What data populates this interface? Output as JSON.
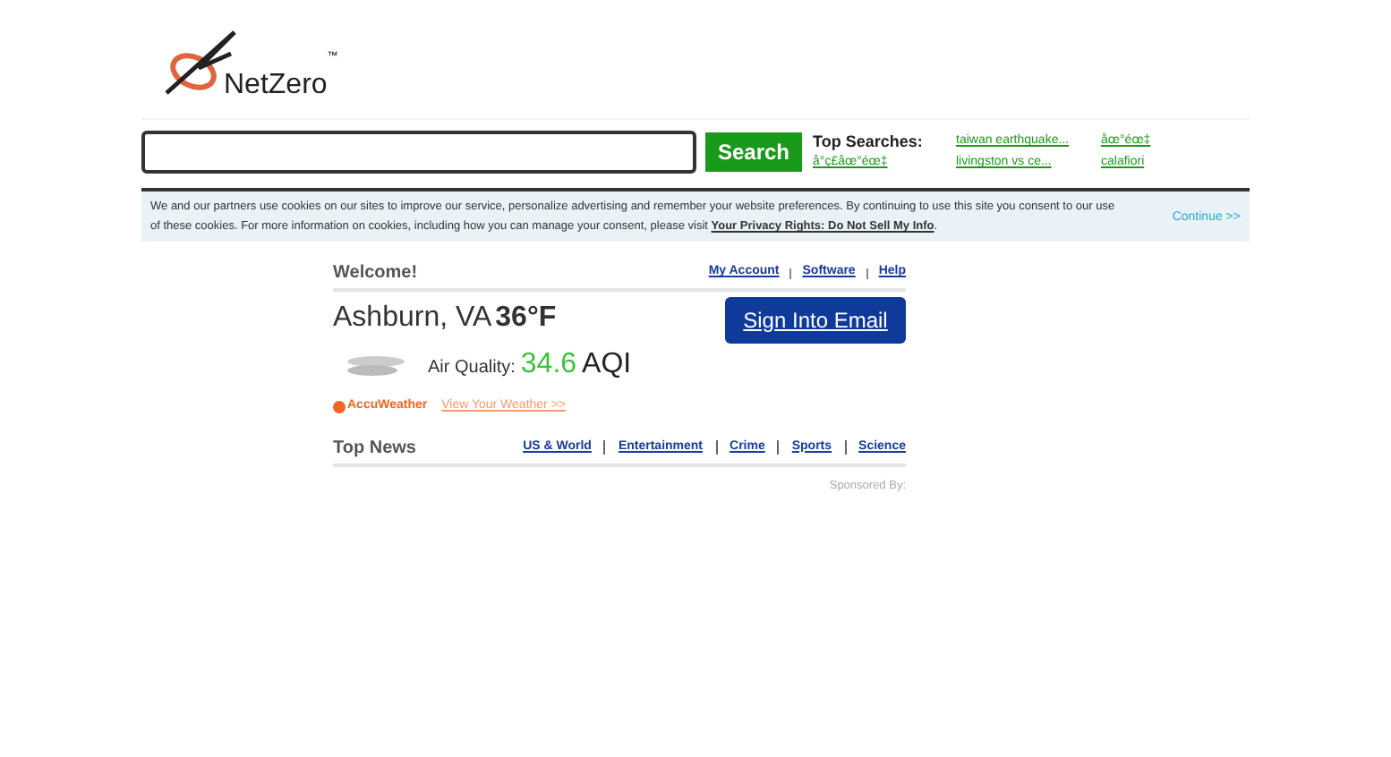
{
  "logo": {
    "name": "NetZero",
    "mark": "™"
  },
  "search": {
    "button": "Search"
  },
  "top_searches": {
    "title": "Top Searches:",
    "items": [
      "å°ç£åœ°éœ‡",
      "taiwan earthquake...",
      "livingston vs ce...",
      "åœ°éœ‡",
      "calafiori"
    ]
  },
  "cookie_notice": {
    "text": "We and our partners use cookies on our sites to improve our service, personalize advertising and remember your website preferences. By continuing to use this site you consent to our use of these cookies. For more information on cookies, including how you can manage your consent, please visit",
    "link": "Your Privacy Rights: Do Not Sell My Info",
    "end": ".",
    "continue": "Continue >>"
  },
  "welcome": {
    "title": "Welcome!",
    "links": [
      "My Account",
      "Software",
      "Help"
    ]
  },
  "weather": {
    "location": "Ashburn, VA",
    "temp": "36°F",
    "aq_label": "Air Quality:",
    "aq_value": "34.6",
    "aq_unit": "AQI",
    "provider": "AccuWeather",
    "link": "View Your Weather >>"
  },
  "sign_in": "Sign Into Email",
  "top_news": {
    "title": "Top News",
    "links": [
      "US & World",
      "Entertainment",
      "Crime",
      "Sports",
      "Science"
    ]
  },
  "sponsored": "Sponsored By:"
}
